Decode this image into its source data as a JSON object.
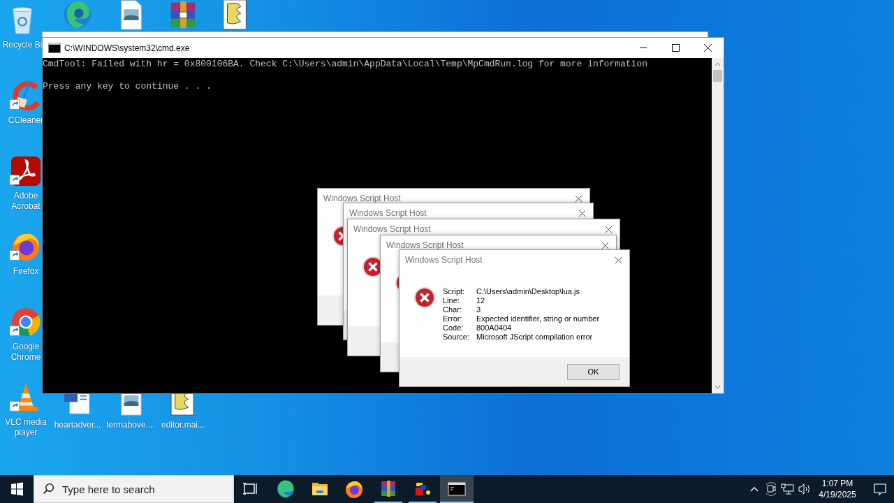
{
  "desktop_icons": [
    {
      "kind": "recycle",
      "label": "Recycle Bi",
      "shortcut": false
    },
    {
      "kind": "edge",
      "shortcut": false
    },
    {
      "kind": "image",
      "shortcut": false
    },
    {
      "kind": "winrar",
      "shortcut": false
    },
    {
      "kind": "script",
      "shortcut": false
    },
    {
      "kind": "ccleaner",
      "label": "CCleaner",
      "shortcut": true
    },
    {
      "kind": "acrobat",
      "label": "Adobe Acrobat",
      "shortcut": true
    },
    {
      "kind": "firefox",
      "label": "Firefox",
      "shortcut": true
    },
    {
      "kind": "chrome",
      "label": "Google Chrome",
      "shortcut": true
    },
    {
      "kind": "vlc",
      "label": "VLC media player",
      "shortcut": true
    },
    {
      "kind": "word",
      "label": "heartadver...",
      "shortcut": false
    },
    {
      "kind": "image",
      "label": "termabove....",
      "shortcut": false
    },
    {
      "kind": "script",
      "label": "editor.mai...",
      "shortcut": false
    }
  ],
  "cmd_window": {
    "title": "C:\\WINDOWS\\system32\\cmd.exe",
    "lines": [
      "CmdTool: Failed with hr = 0x800106BA. Check C:\\Users\\admin\\AppData\\Local\\Temp\\MpCmdRun.log for more information",
      "Press any key to continue . . ."
    ]
  },
  "dialogs": [
    {
      "title": "Windows Script Host",
      "kind": "error"
    },
    {
      "title": "Windows Script Host",
      "kind": "covered"
    },
    {
      "title": "Windows Script Host",
      "kind": "error"
    },
    {
      "title": "Windows Script Host",
      "kind": "error"
    },
    {
      "title": "Windows Script Host",
      "kind": "error",
      "fields": [
        {
          "label": "Script:",
          "value": "C:\\Users\\admin\\Desktop\\lua.js"
        },
        {
          "label": "Line:",
          "value": "12"
        },
        {
          "label": "Char:",
          "value": "3"
        },
        {
          "label": "Error:",
          "value": "Expected identifier, string or number"
        },
        {
          "label": "Code:",
          "value": "800A0404"
        },
        {
          "label": "Source:",
          "value": "Microsoft JScript compilation error"
        }
      ],
      "button": "OK"
    }
  ],
  "taskbar": {
    "search_placeholder": "Type here to search",
    "apps": [
      {
        "kind": "taskview",
        "running": false,
        "selected": false
      },
      {
        "kind": "edge",
        "running": false,
        "selected": false
      },
      {
        "kind": "folder",
        "running": false,
        "selected": false
      },
      {
        "kind": "firefox",
        "running": false,
        "selected": false
      },
      {
        "kind": "winrar",
        "running": true,
        "selected": false
      },
      {
        "kind": "app",
        "running": true,
        "selected": false
      },
      {
        "kind": "cmd",
        "running": true,
        "selected": true
      }
    ],
    "time": "1:07 PM",
    "date": "4/19/2025"
  }
}
